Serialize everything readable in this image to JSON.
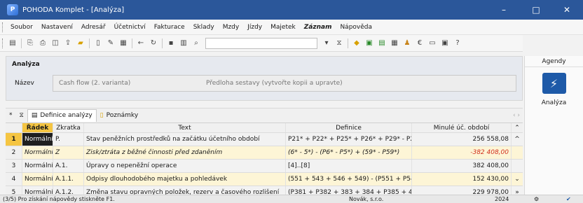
{
  "window": {
    "title": "POHODA Komplet - [Analýza]",
    "app_icon": "pohoda-icon",
    "btn_min": "–",
    "btn_max": "□",
    "btn_close": "✕"
  },
  "menu": [
    "Soubor",
    "Nastavení",
    "Adresář",
    "Účetnictví",
    "Fakturace",
    "Sklady",
    "Mzdy",
    "Jízdy",
    "Majetek",
    "Záznam",
    "Nápověda"
  ],
  "header": {
    "section": "Analýza",
    "name_label": "Název",
    "name_value": "Cash flow (2. varianta)",
    "template_text": "Předloha sestavy (vytvořte kopii a upravte)"
  },
  "tabs": {
    "star": "*",
    "filter": "⧖",
    "tab1": "Definice analýzy",
    "tab2": "Poznámky",
    "nav": "‹ ›"
  },
  "columns": {
    "radek": "Řádek",
    "zkratka": "Zkratka",
    "text": "Text",
    "definice": "Definice",
    "minule": "Minulé úč. období"
  },
  "rows": [
    {
      "n": "1",
      "radek": "Normální",
      "zkratka": "P.",
      "text": "Stav peněžních prostředků na začátku účetního období",
      "definice": "P21* + P22* + P25* + P26* + P29* - P252 ...",
      "minule": "256 558,08"
    },
    {
      "n": "2",
      "radek": "Normální",
      "zkratka": "Z",
      "text": "Zisk/ztráta z běžné činnosti před zdaněním",
      "definice": "(6* - 5*) - (P6* - P5*) + (59* - P59*)",
      "minule": "-382 408,00"
    },
    {
      "n": "3",
      "radek": "Normální",
      "zkratka": "A.1.",
      "text": "Úpravy o nepeněžní operace",
      "definice": "[4]..[8]",
      "minule": "382 408,00"
    },
    {
      "n": "4",
      "radek": "Normální",
      "zkratka": "A.1.1.",
      "text": "Odpisy dlouhodobého majetku a pohledávek",
      "definice": "(551 + 543 + 546 + 549) - (P551 + P543 + ...",
      "minule": "152 430,00"
    },
    {
      "n": "5",
      "radek": "Normální",
      "zkratka": "A.1.2.",
      "text": "Změna stavu opravných položek, rezerv a časového rozlišení",
      "definice": "(P381 + P382 + 383 + 384 + P385 + 45*) - ...",
      "minule": "229 978,00"
    }
  ],
  "agendy": {
    "title": "Agendy",
    "label": "Analýza"
  },
  "status": {
    "hint": "(3/5) Pro získání nápovědy stiskněte F1.",
    "company": "Novák, s.r.o.",
    "year": "2024"
  }
}
